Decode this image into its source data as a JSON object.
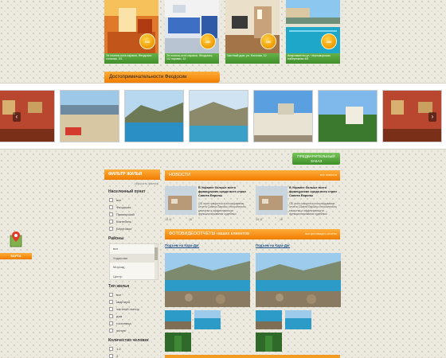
{
  "top_cards": [
    {
      "caption": "Эт хлопка-оста парами, Феодосия соляная, 3/1",
      "price": "220"
    },
    {
      "caption": "Эт хлопка-оста парами, Феодосия, 1/2 парами, 12",
      "price": "250"
    },
    {
      "caption": "Частный дом, ул. Косолая, 12",
      "price": "150"
    },
    {
      "caption": "Апартаменты ул. Черноморская набережная 4/8",
      "price": "280"
    }
  ],
  "sights": {
    "title": "Достопримечательности Феодосии",
    "prev_arrow": "‹",
    "next_arrow": "›"
  },
  "request_button": "ПРЕДВАРИТЕЛЬНЫЙ ЗАКАЗ",
  "filter": {
    "title": "ФИЛЬТР ЖИЛЬЯ",
    "reset": "сбросить фильтр",
    "settlement_title": "Населенный пункт",
    "settlements": [
      "все",
      "Феодосия",
      "Приморский",
      "Коктебель",
      "Береговое"
    ],
    "districts_title": "Районы",
    "districts": [
      "все",
      "Ходасова",
      "Морсад",
      "Центр"
    ],
    "housing_title": "Тип жилья",
    "housing_types": [
      "все",
      "квартиры",
      "частный сектор",
      "дом",
      "гостиница",
      "эллинг"
    ],
    "people_title": "Количество человек",
    "people": [
      "1-2",
      "3"
    ]
  },
  "map_widget": {
    "label": "КАРТА"
  },
  "news": {
    "title": "НОВОСТИ",
    "more": "все новости",
    "items": [
      {
        "title": "В Украине больше всего французских среди всех стран Совета Европы",
        "text": "ОБ этом говорится в исследовании отчета Совета Европы относительно качества и эффективности функционирования судебных",
        "date": "15.11",
        "count": "16"
      },
      {
        "title": "В Украине больше всего французских среди всех стран Совета Европы",
        "text": "ОБ этом говорится в исследовании отчета Совета Европы относительно качества и эффективности функционирования судебных",
        "date": "15.11",
        "count": "16"
      }
    ]
  },
  "reports": {
    "title": "ФОТОВИДЕООТЧЕТЫ наших клиентов",
    "more": "все фотовидео-отчеты",
    "items": [
      {
        "title": "Подъем на Кара-Даг"
      },
      {
        "title": "Подъем на Кара-Даг"
      }
    ]
  },
  "colors": {
    "orange": "#f07c00",
    "green": "#3f8f2b",
    "background": "#eceae0"
  }
}
